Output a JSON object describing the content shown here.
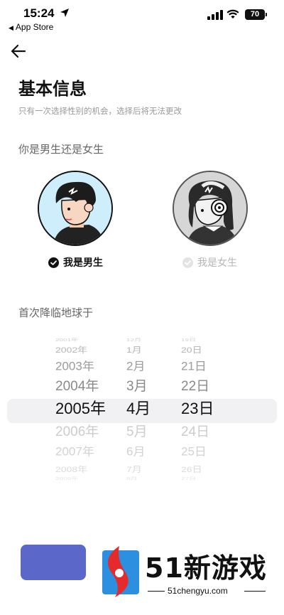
{
  "status_bar": {
    "time": "15:24",
    "back_app": "App Store",
    "battery": "70"
  },
  "header": {
    "title": "基本信息",
    "subtitle": "只有一次选择性别的机会，选择后将无法更改"
  },
  "gender": {
    "question": "你是男生还是女生",
    "options": [
      {
        "label": "我是男生",
        "selected": true
      },
      {
        "label": "我是女生",
        "selected": false
      }
    ]
  },
  "birthday": {
    "question": "首次降临地球于",
    "years": [
      "2001年",
      "2002年",
      "2003年",
      "2004年",
      "2005年",
      "2006年",
      "2007年",
      "2008年",
      "2009年"
    ],
    "months": [
      "12月",
      "1月",
      "2月",
      "3月",
      "4月",
      "5月",
      "6月",
      "7月",
      "8月"
    ],
    "days": [
      "19日",
      "20日",
      "21日",
      "22日",
      "23日",
      "24日",
      "25日",
      "26日",
      "27日"
    ],
    "selected": {
      "year": "2005年",
      "month": "4月",
      "day": "23日"
    }
  },
  "watermark": {
    "brand": "51新游戏",
    "url": "51chengyu.com"
  },
  "colors": {
    "accent": "#5b67c9",
    "male_bg": "#cfeefb",
    "female_bg": "#d6d6d6"
  },
  "icons": [
    "location-arrow-icon",
    "signal-icon",
    "wifi-icon",
    "battery-icon",
    "back-arrow-icon",
    "check-circle-icon"
  ]
}
